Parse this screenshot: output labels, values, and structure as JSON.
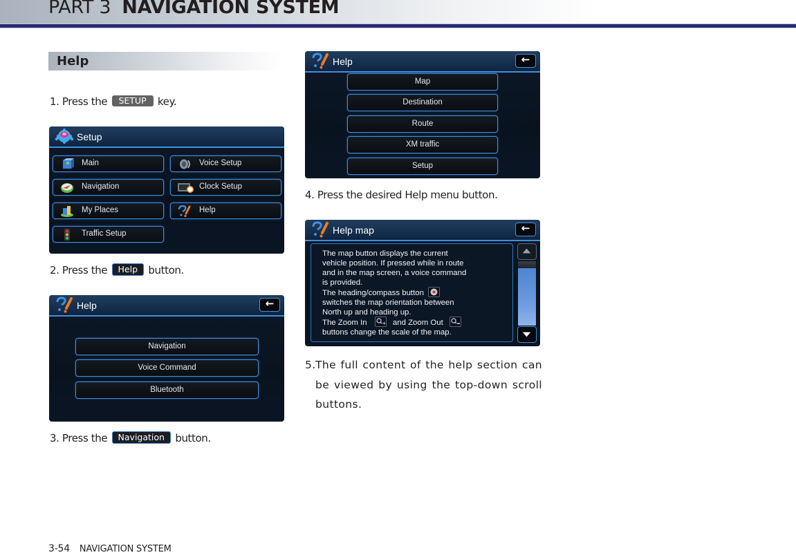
{
  "header": {
    "part": "PART 3",
    "title": "NAVIGATION SYSTEM",
    "rule_color": "#272a72"
  },
  "section": {
    "heading": "Help"
  },
  "steps": [
    {
      "number": "1.",
      "before": "Press the",
      "badge": "SETUP",
      "after": "key."
    },
    {
      "number": "2.",
      "before": "Press the",
      "badge": "Help",
      "after": "button."
    },
    {
      "number": "3.",
      "before": "Press the",
      "badge": "Navigation",
      "after": "button."
    },
    {
      "number": "4.",
      "text": "Press the desired Help menu button."
    },
    {
      "number": "5.",
      "text": "The full content of the help section can be viewed by using the top-down scroll buttons."
    }
  ],
  "screens": {
    "setup": {
      "title": "Setup",
      "title_icon": "gear-icon",
      "buttons": [
        {
          "label": "Main",
          "icon": "main-cube-icon"
        },
        {
          "label": "Voice Setup",
          "icon": "speaker-icon"
        },
        {
          "label": "Navigation",
          "icon": "navigation-compass-icon"
        },
        {
          "label": "Clock Setup",
          "icon": "clock-icon"
        },
        {
          "label": "My Places",
          "icon": "my-places-icon"
        },
        {
          "label": "Help",
          "icon": "help-question-icon"
        },
        {
          "label": "Traffic Setup",
          "icon": "traffic-light-icon"
        }
      ]
    },
    "help": {
      "title": "Help",
      "title_icon": "help-question-icon",
      "back_icon": "back-arrow-icon",
      "buttons": [
        "Navigation",
        "Voice Command",
        "Bluetooth"
      ]
    },
    "help_navigation": {
      "title": "Help",
      "title_icon": "help-question-icon",
      "back_icon": "back-arrow-icon",
      "buttons": [
        "Map",
        "Destination",
        "Route",
        "XM traffic",
        "Setup"
      ]
    },
    "help_map": {
      "title": "Help map",
      "title_icon": "help-question-icon",
      "back_icon": "back-arrow-icon",
      "lines": [
        "The map button displays the current",
        "vehicle position. If pressed while in route",
        "and in the map screen, a voice command",
        "is provided.",
        "The heading/compass button",
        "switches the map orientation between",
        "North up and heading up.",
        "The Zoom In",
        "and Zoom Out",
        "buttons change the scale of the map."
      ],
      "scroll_up_icon": "scroll-up-icon",
      "scroll_down_icon": "scroll-down-icon",
      "inline_icons": [
        "compass-icon",
        "zoom-in-icon",
        "zoom-out-icon"
      ]
    }
  },
  "footer": {
    "page_number": "3-54",
    "section": "NAVIGATION SYSTEM"
  },
  "colors": {
    "screen_border": "#3d8be0",
    "scroll_thumb": "#5d8fd6",
    "setup_badge": "#626365"
  }
}
